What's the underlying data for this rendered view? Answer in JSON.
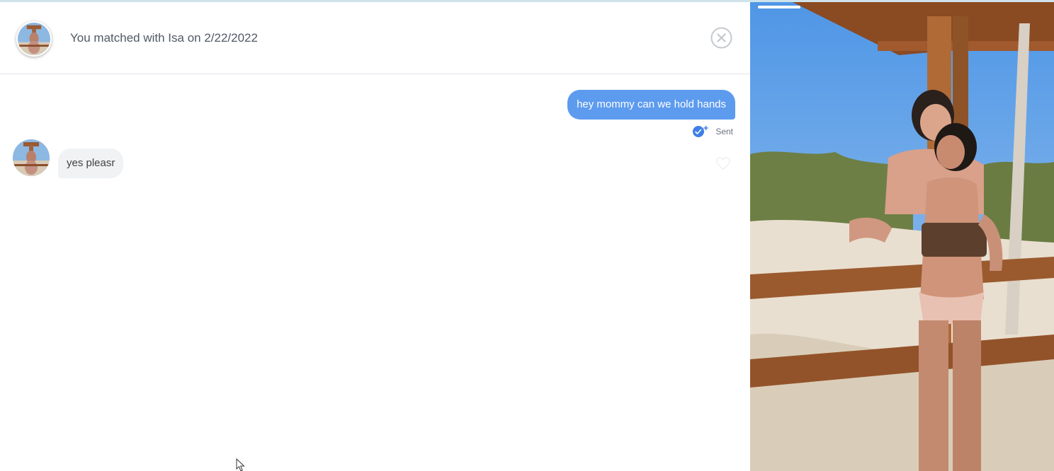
{
  "header": {
    "match_text": "You matched with Isa on 2/22/2022"
  },
  "messages": {
    "outgoing": {
      "text": "hey mommy can we hold hands",
      "status": "Sent"
    },
    "incoming": {
      "text": "yes pleasr"
    }
  },
  "icons": {
    "close": "close-circle-icon",
    "sent": "read-receipt-icon",
    "like": "heart-outline-icon",
    "cursor": "mouse-pointer-icon"
  },
  "colors": {
    "outgoing_bubble": "#5d9bef",
    "incoming_bubble": "#f0f2f4",
    "divider": "#e0e3e8",
    "accent_blue": "#3f7fe6"
  },
  "photo": {
    "story_progress": 0.14
  }
}
